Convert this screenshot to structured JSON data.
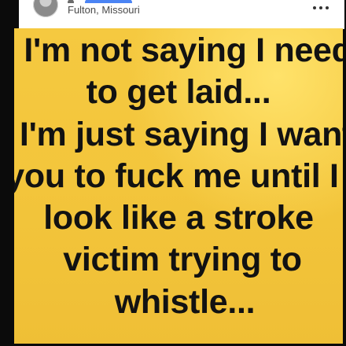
{
  "post": {
    "location": "Fulton, Missouri",
    "more_icon": "more-horizontal-icon",
    "avatar_icon": "avatar"
  },
  "meme": {
    "background_color": "#f4c63e",
    "text_color": "#121212",
    "lines": [
      "I'm not saying I need",
      "to get laid...",
      "I'm just saying I want",
      "you to fuck me until I",
      "look like a stroke",
      "victim trying to",
      "whistle..."
    ]
  }
}
